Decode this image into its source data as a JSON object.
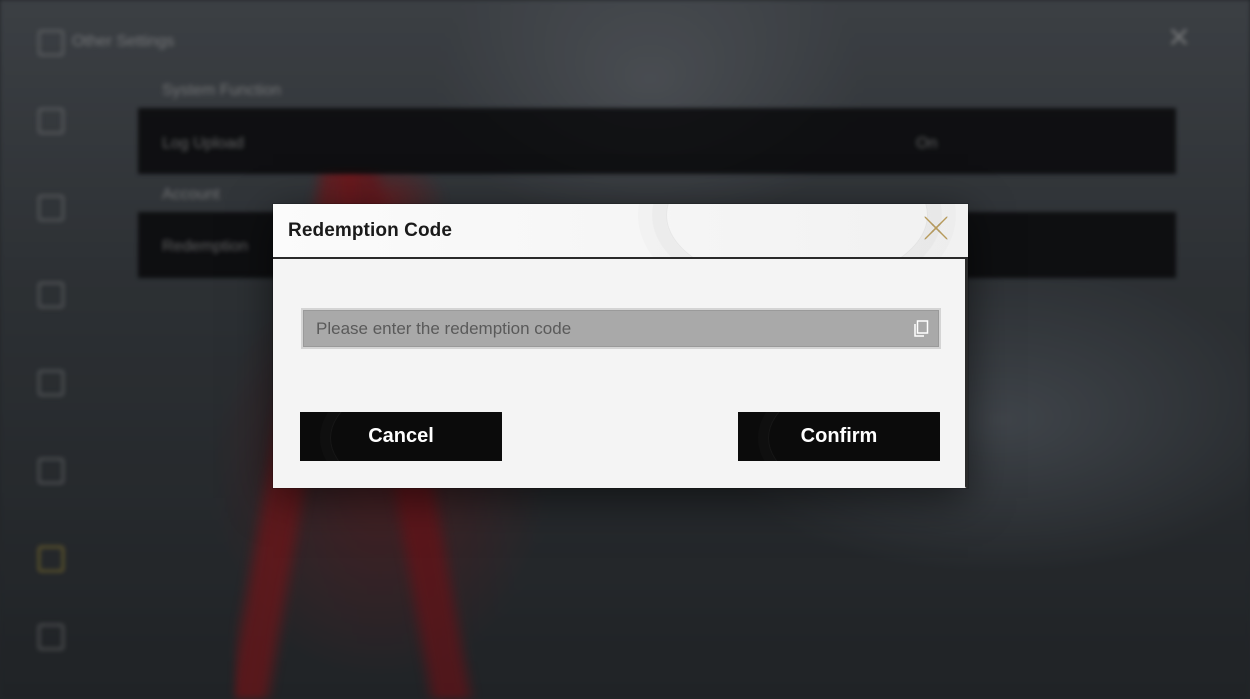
{
  "background": {
    "settings_title": "Other Settings",
    "section_1_label": "System Function",
    "row_1_label": "Log Upload",
    "row_1_value": "On",
    "section_2_label": "Account",
    "row_2_label": "Redemption"
  },
  "dialog": {
    "title": "Redemption Code",
    "input_placeholder": "Please enter the redemption code",
    "input_value": "",
    "cancel_label": "Cancel",
    "confirm_label": "Confirm",
    "close_icon": "close-x-icon",
    "paste_icon": "paste-icon"
  },
  "colors": {
    "dialog_bg": "#f4f4f4",
    "button_bg": "#0b0b0b",
    "input_bg": "#a9a9a9",
    "accent": "#b79a5a"
  }
}
